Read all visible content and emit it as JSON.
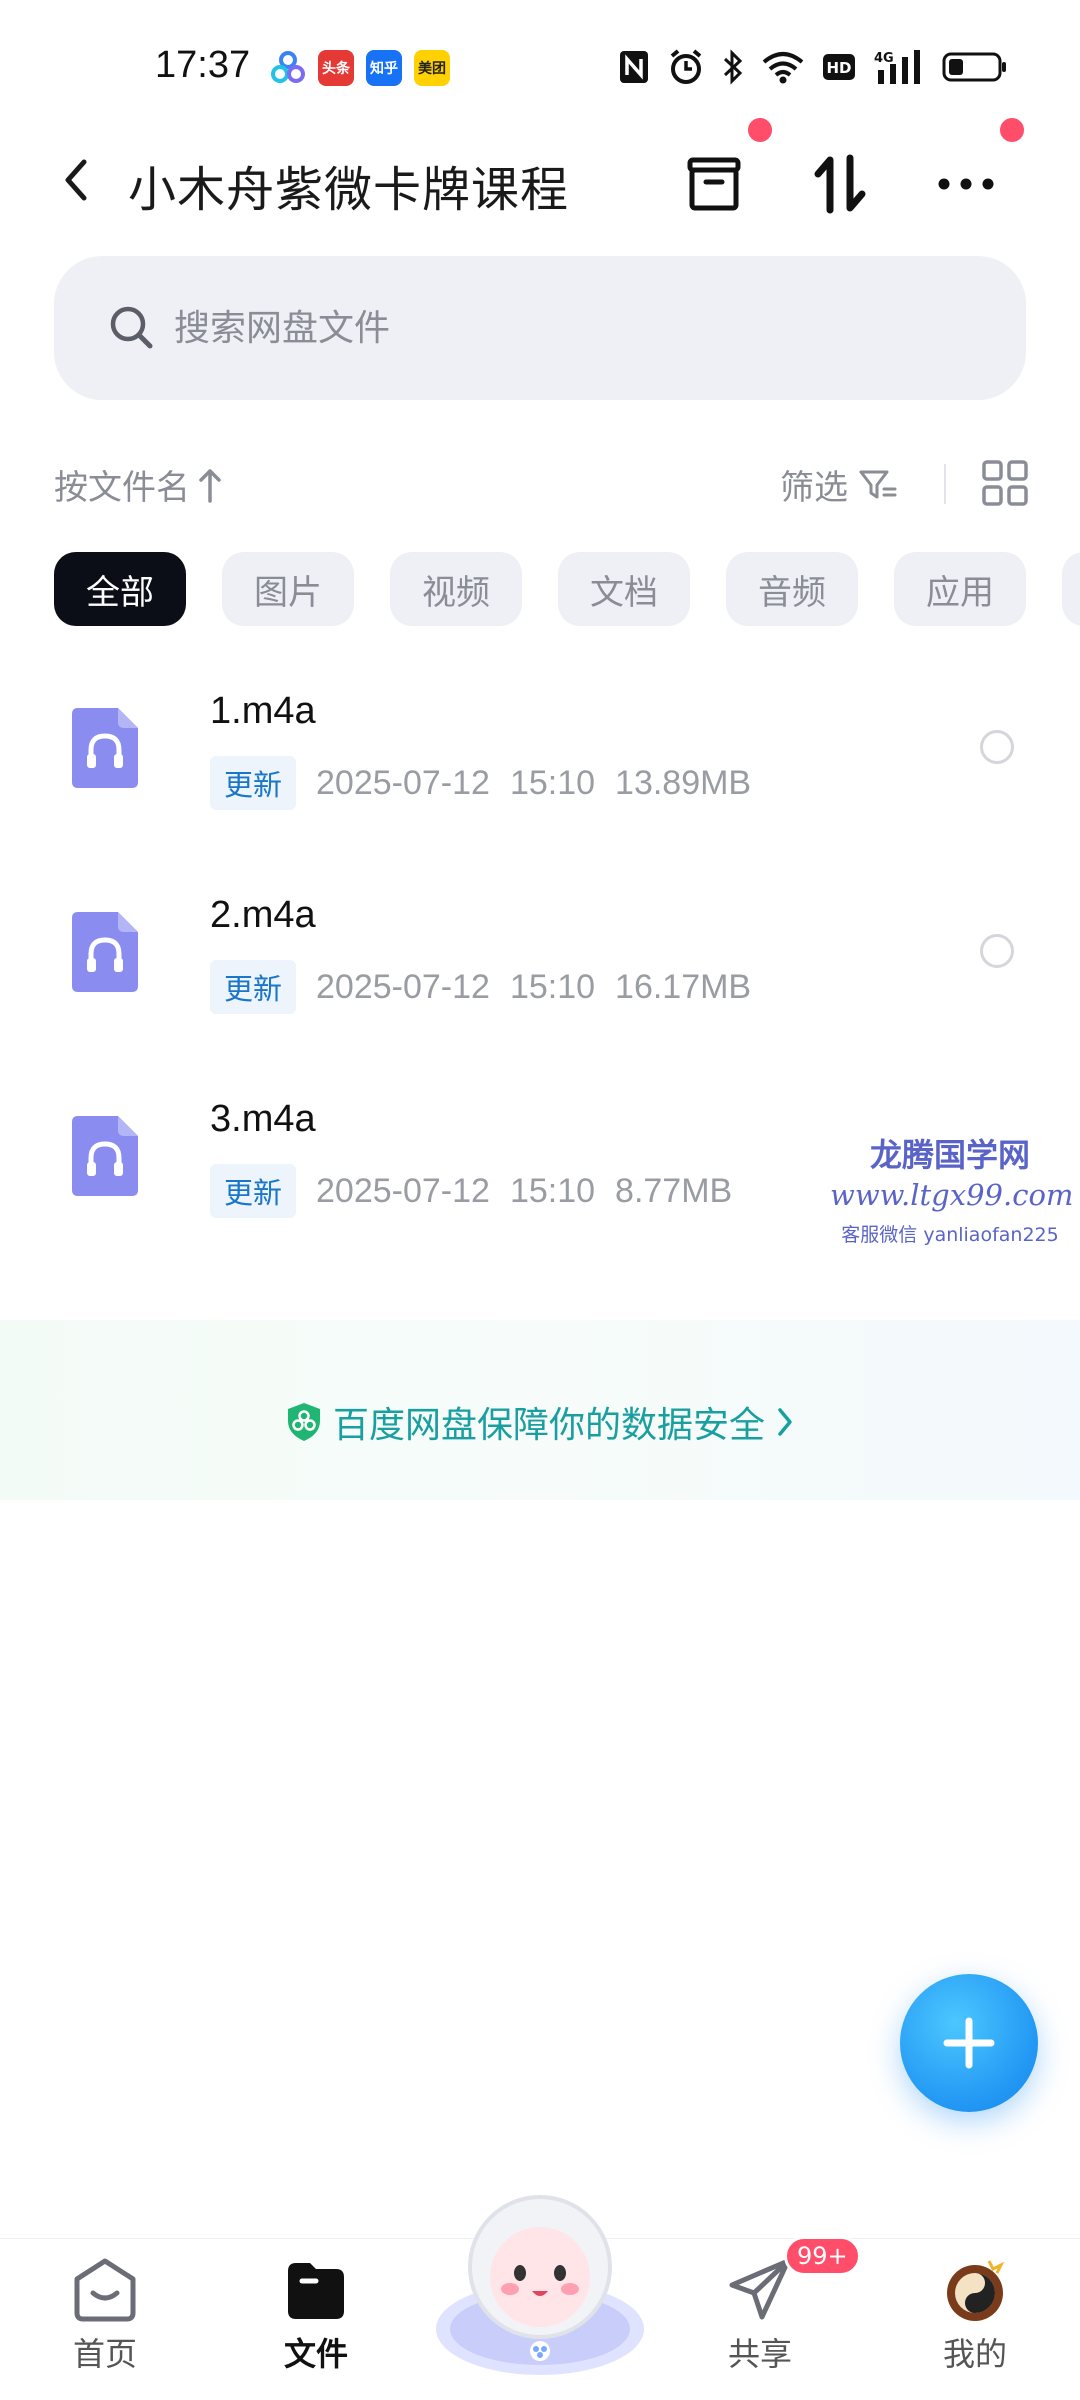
{
  "status_bar": {
    "time": "17:37",
    "apps": [
      {
        "name": "baidu-netdisk-app-icon",
        "label": "",
        "color": "#3b82f6"
      },
      {
        "name": "toutiao-app-icon",
        "label": "头条",
        "color": "#e53935"
      },
      {
        "name": "zhihu-app-icon",
        "label": "知乎",
        "color": "#1772f6"
      },
      {
        "name": "meituan-app-icon",
        "label": "美团",
        "color": "#ffd100"
      }
    ],
    "network": "4G",
    "hd": "HD"
  },
  "header": {
    "title": "小木舟紫微卡牌课程"
  },
  "search": {
    "placeholder": "搜索网盘文件"
  },
  "sort": {
    "label": "按文件名",
    "filter_label": "筛选"
  },
  "categories": {
    "items": [
      "全部",
      "图片",
      "视频",
      "文档",
      "音频",
      "应用"
    ],
    "active": "全部"
  },
  "files": [
    {
      "name": "1.m4a",
      "tag": "更新",
      "date": "2025-07-12",
      "time": "15:10",
      "size": "13.89MB"
    },
    {
      "name": "2.m4a",
      "tag": "更新",
      "date": "2025-07-12",
      "time": "15:10",
      "size": "16.17MB"
    },
    {
      "name": "3.m4a",
      "tag": "更新",
      "date": "2025-07-12",
      "time": "15:10",
      "size": "8.77MB"
    }
  ],
  "watermark": {
    "line1": "龙腾国学网",
    "line2": "www.ltgx99.com",
    "line3": "客服微信 yanliaofan225"
  },
  "security": {
    "text": "百度网盘保障你的数据安全"
  },
  "nav": {
    "home": "首页",
    "files": "文件",
    "share": "共享",
    "me": "我的",
    "share_badge": "99+"
  },
  "colors": {
    "accent": "#2196f3",
    "active_chip": "#0b0d17",
    "red_dot": "#ff4d6a",
    "audio_icon": "#8b8cf0",
    "security_text": "#1a9fa0"
  }
}
